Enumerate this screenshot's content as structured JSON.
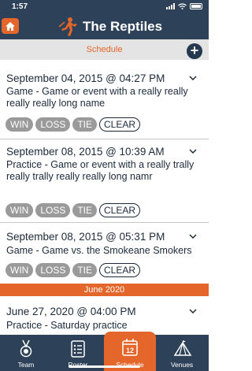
{
  "status": {
    "time": "1:57"
  },
  "header": {
    "team_name": "The Reptiles"
  },
  "section": {
    "title": "Schedule"
  },
  "events": [
    {
      "datetime": "September 04, 2015 @ 04:27 PM",
      "name": "Game - Game or event with a really really really really long name"
    },
    {
      "datetime": "September 08, 2015 @ 10:39 AM",
      "name": "Practice - Game or event with a really trally really trally really really  long namr"
    },
    {
      "datetime": "September 08, 2015 @ 05:31 PM",
      "name": "Game - Game vs. the Smokeane Smokers"
    },
    {
      "datetime": "June 27, 2020 @ 04:00 PM",
      "name": "Practice - Saturday practice"
    }
  ],
  "result_buttons": {
    "win": "WIN",
    "loss": "LOSS",
    "tie": "TIE",
    "clear": "CLEAR"
  },
  "month_divider": "June 2020",
  "tabs": [
    {
      "label": "Team",
      "icon": "medal-icon"
    },
    {
      "label": "Roster",
      "icon": "roster-icon"
    },
    {
      "label": "Schedule",
      "icon": "calendar-icon",
      "active": true,
      "badge": "12"
    },
    {
      "label": "Venues",
      "icon": "tent-icon"
    }
  ],
  "colors": {
    "navy": "#2d4258",
    "orange": "#e4662a",
    "gray_pill": "#9a9a9a"
  }
}
